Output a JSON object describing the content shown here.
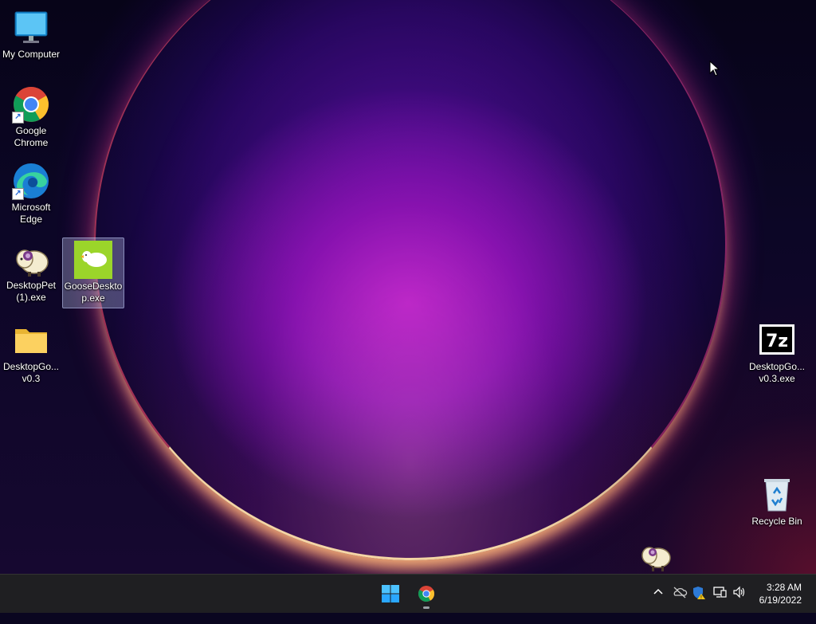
{
  "desktop": {
    "icons": [
      {
        "label": "My Computer"
      },
      {
        "label": "Google Chrome"
      },
      {
        "label": "Microsoft Edge"
      },
      {
        "label": "DesktopPet (1).exe"
      },
      {
        "label": "GooseDesktop.exe"
      },
      {
        "label": "DesktopGo... v0.3"
      },
      {
        "label": "DesktopGo... v0.3.exe"
      },
      {
        "label": "Recycle Bin"
      }
    ],
    "sevenzip_text": "7z"
  },
  "taskbar": {
    "clock_time": "3:28 AM",
    "clock_date": "6/19/2022",
    "accent": "#0078d4"
  }
}
